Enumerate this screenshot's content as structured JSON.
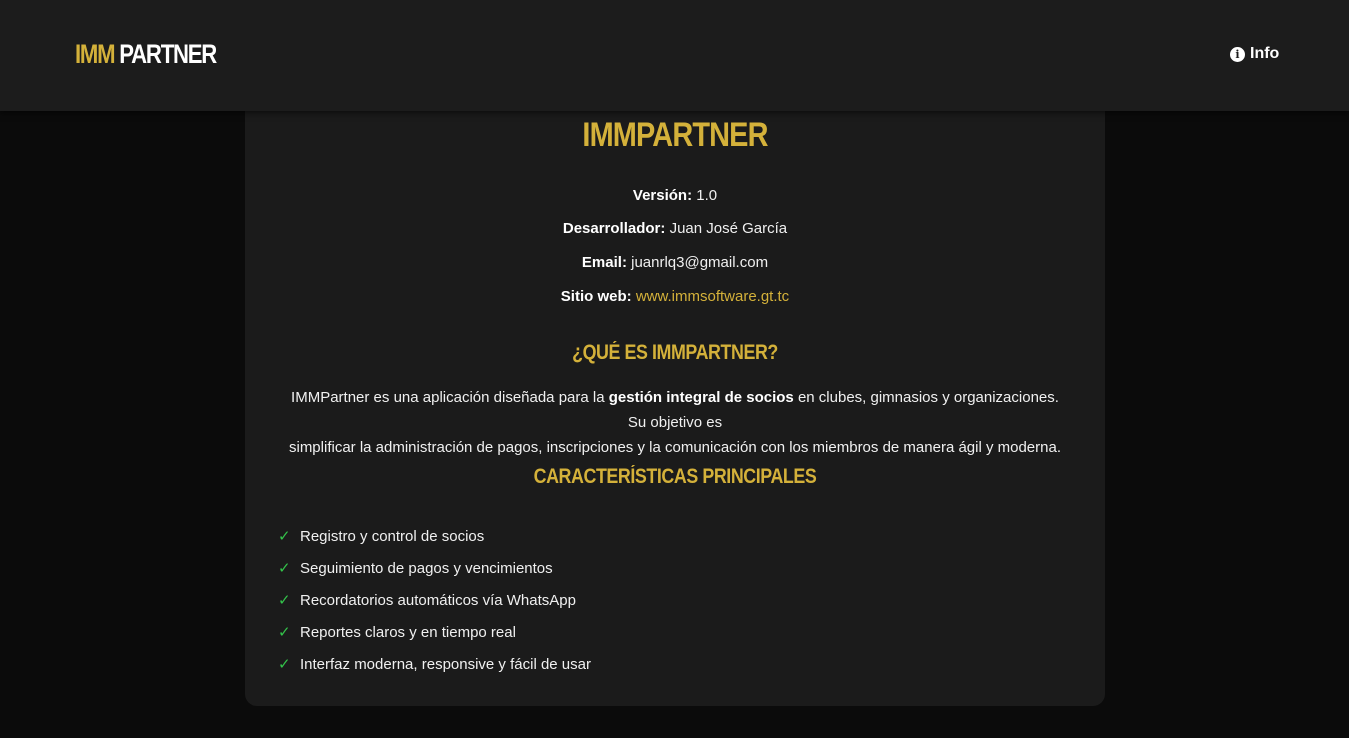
{
  "nav": {
    "brand_part1": "IMM",
    "brand_part2": "PARTNER",
    "info_label": "Info",
    "info_icon": "info-circle-icon"
  },
  "card": {
    "title": "IMMPARTNER",
    "version_label": "Versión:",
    "version_value": "1.0",
    "developer_label": "Desarrollador:",
    "developer_value": "Juan José García",
    "email_label": "Email:",
    "email_value": "juanrlq3@gmail.com",
    "website_label": "Sitio web:",
    "website_value": "www.immsoftware.gt.tc",
    "what_is_heading": "¿QUÉ ES IMMPARTNER?",
    "desc_before": "IMMPartner es una aplicación diseñada para la ",
    "desc_bold": "gestión integral de socios",
    "desc_after_line1": " en clubes, gimnasios y organizaciones. Su objetivo es",
    "desc_line2": "simplificar la administración de pagos, inscripciones y la comunicación con los miembros de manera ágil y moderna.",
    "features_heading": "CARACTERÍSTICAS PRINCIPALES",
    "features": [
      "Registro y control de socios",
      "Seguimiento de pagos y vencimientos",
      "Recordatorios automáticos vía WhatsApp",
      "Reportes claros y en tiempo real",
      "Interfaz moderna, responsive y fácil de usar"
    ],
    "check_icon": "check-icon"
  },
  "colors": {
    "accent": "#d4b13a",
    "check": "#33c24a",
    "background": "#0b0b0b",
    "card": "#1b1b1b",
    "navbar": "#1c1c1c"
  }
}
